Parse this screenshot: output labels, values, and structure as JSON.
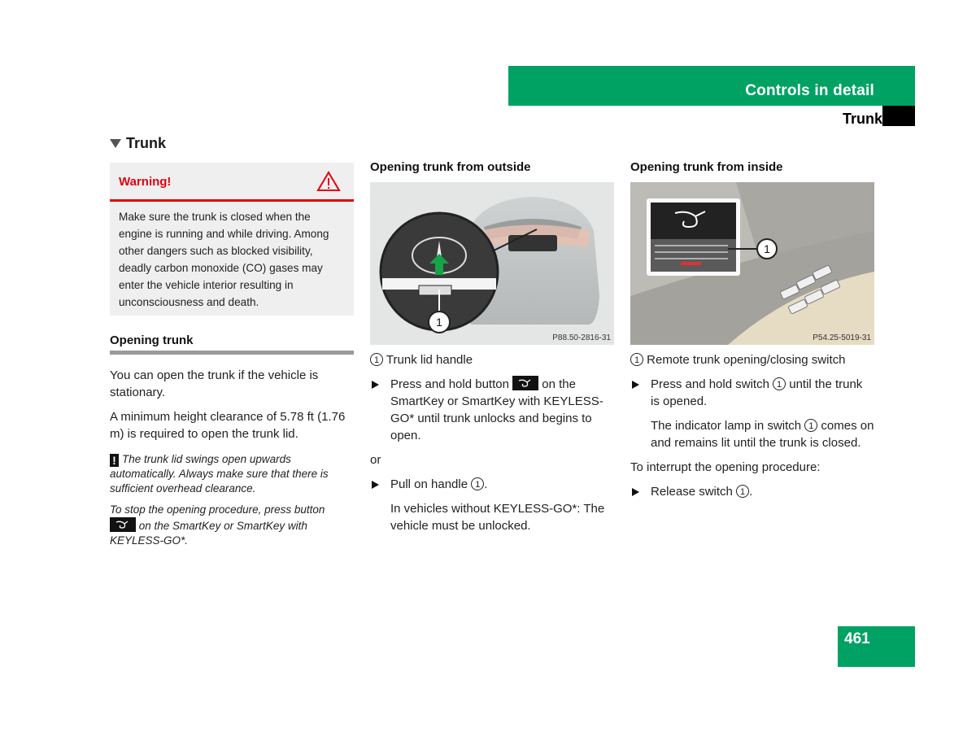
{
  "header": {
    "chapter": "Controls in detail",
    "section": "Trunk",
    "accent_color": "#00a264"
  },
  "section_title": "Trunk",
  "warning": {
    "label": "Warning!",
    "icon": "warning-triangle-icon",
    "color": "#e3000f",
    "text": "Make sure the trunk is closed when the engine is running and while driving. Among other dangers such as blocked visibility, deadly carbon monoxide (CO) gases may enter the vehicle interior resulting in unconsciousness and death."
  },
  "opening_trunk": {
    "heading": "Opening trunk",
    "para1": "You can open the trunk if the vehicle is stationary.",
    "para2": "A minimum height clearance of 5.78 ft (1.76 m) is required to open the trunk lid.",
    "note1": "The trunk lid swings open upwards automatically. Always make sure that there is sufficient overhead clearance.",
    "note2_before": "To stop the opening procedure, press button",
    "note2_after": "on the SmartKey or SmartKey with KEYLESS-GO*."
  },
  "from_outside": {
    "heading": "Opening trunk from outside",
    "figure_code": "P88.50-2816-31",
    "callout": "1",
    "legend": "Trunk lid handle",
    "step1_before": "Press and hold button",
    "step1_after": "on the SmartKey or SmartKey with KEYLESS-GO* until trunk unlocks and begins to open.",
    "or": "or",
    "step2_before": "Pull on handle",
    "step2_after": ".",
    "step2_note": "In vehicles without KEYLESS-GO*: The vehicle must be unlocked."
  },
  "from_inside": {
    "heading": "Opening trunk from inside",
    "figure_code": "P54.25-5019-31",
    "callout": "1",
    "legend": "Remote trunk opening/closing switch",
    "step1_before": "Press and hold switch",
    "step1_after": "until the trunk is opened.",
    "step1_note_before": "The indicator lamp in switch",
    "step1_note_after": "comes on and remains lit until the trunk is closed.",
    "interrupt": "To interrupt the opening procedure:",
    "step2_before": "Release switch",
    "step2_after": "."
  },
  "page_number": "461"
}
